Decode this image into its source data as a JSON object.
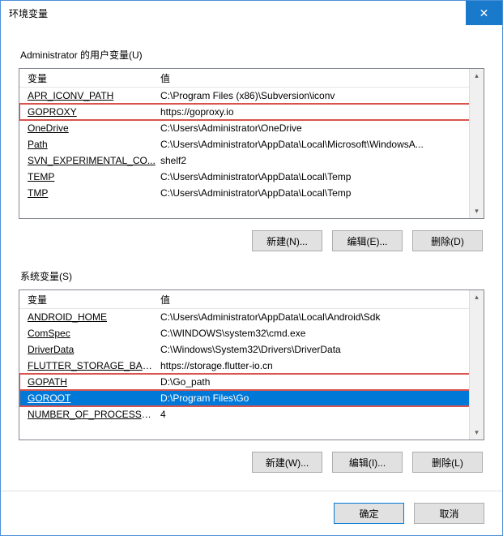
{
  "title": "环境变量",
  "userSection": {
    "label": "Administrator 的用户变量(U)",
    "headerName": "变量",
    "headerValue": "值",
    "rows": [
      {
        "name": "APR_ICONV_PATH",
        "value": "C:\\Program Files (x86)\\Subversion\\iconv",
        "hl": false,
        "sel": false
      },
      {
        "name": "GOPROXY",
        "value": "https://goproxy.io",
        "hl": true,
        "sel": false
      },
      {
        "name": "OneDrive",
        "value": "C:\\Users\\Administrator\\OneDrive",
        "hl": false,
        "sel": false
      },
      {
        "name": "Path",
        "value": "C:\\Users\\Administrator\\AppData\\Local\\Microsoft\\WindowsA...",
        "hl": false,
        "sel": false
      },
      {
        "name": "SVN_EXPERIMENTAL_CO...",
        "value": "shelf2",
        "hl": false,
        "sel": false
      },
      {
        "name": "TEMP",
        "value": "C:\\Users\\Administrator\\AppData\\Local\\Temp",
        "hl": false,
        "sel": false
      },
      {
        "name": "TMP",
        "value": "C:\\Users\\Administrator\\AppData\\Local\\Temp",
        "hl": false,
        "sel": false
      }
    ],
    "buttons": {
      "new": "新建(N)...",
      "edit": "编辑(E)...",
      "delete": "删除(D)"
    }
  },
  "sysSection": {
    "label": "系统变量(S)",
    "headerName": "变量",
    "headerValue": "值",
    "rows": [
      {
        "name": "ANDROID_HOME",
        "value": "C:\\Users\\Administrator\\AppData\\Local\\Android\\Sdk",
        "hl": false,
        "sel": false
      },
      {
        "name": "ComSpec",
        "value": "C:\\WINDOWS\\system32\\cmd.exe",
        "hl": false,
        "sel": false
      },
      {
        "name": "DriverData",
        "value": "C:\\Windows\\System32\\Drivers\\DriverData",
        "hl": false,
        "sel": false
      },
      {
        "name": "FLUTTER_STORAGE_BASE_...",
        "value": "https://storage.flutter-io.cn",
        "hl": false,
        "sel": false
      },
      {
        "name": "GOPATH",
        "value": "D:\\Go_path",
        "hl": true,
        "sel": false
      },
      {
        "name": "GOROOT",
        "value": "D:\\Program Files\\Go",
        "hl": true,
        "sel": true
      },
      {
        "name": "NUMBER_OF_PROCESSORS",
        "value": "4",
        "hl": false,
        "sel": false
      }
    ],
    "buttons": {
      "new": "新建(W)...",
      "edit": "编辑(I)...",
      "delete": "删除(L)"
    }
  },
  "footer": {
    "ok": "确定",
    "cancel": "取消"
  }
}
